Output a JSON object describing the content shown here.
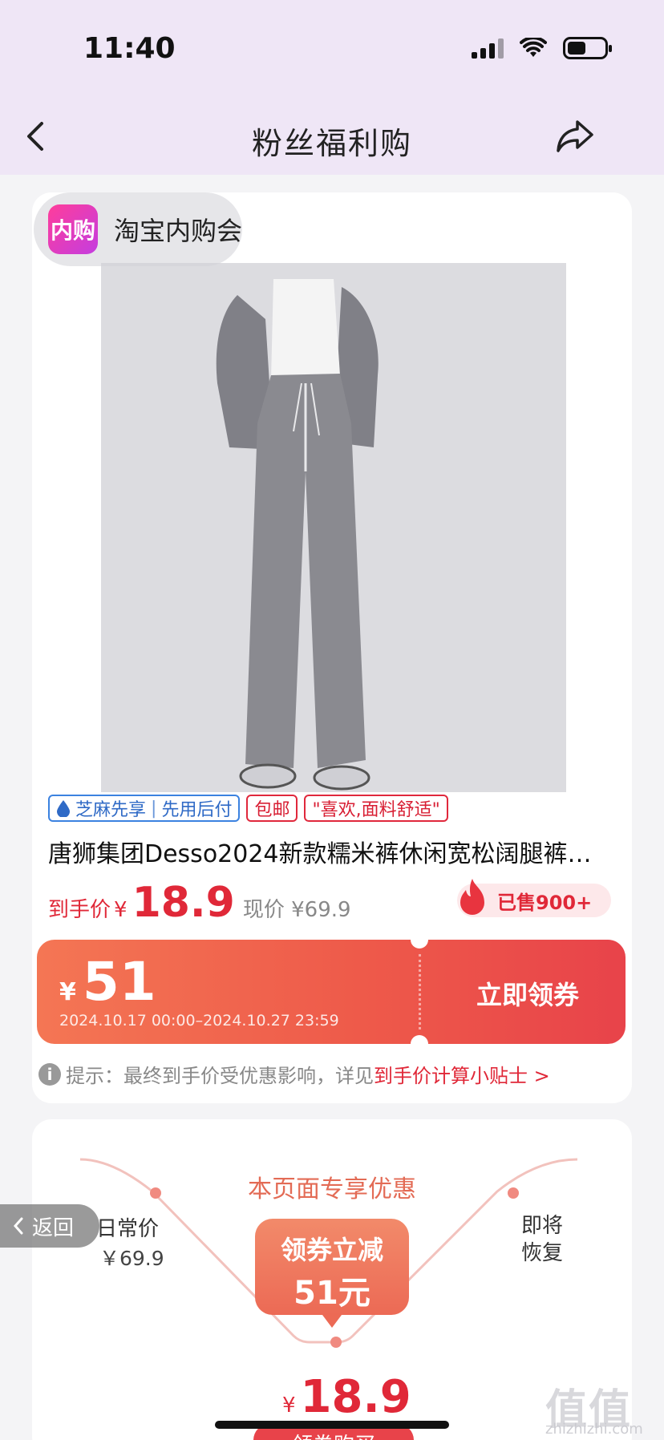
{
  "status_bar": {
    "time": "11:40"
  },
  "nav": {
    "title": "粉丝福利购"
  },
  "shop": {
    "logo_text": "内购",
    "name": "淘宝内购会"
  },
  "product": {
    "tags": {
      "zhima": "芝麻先享",
      "pay_later": "先用后付",
      "free_shipping": "包邮",
      "review": "\"喜欢,面料舒适\""
    },
    "title": "唐狮集团Desso2024新款糯米裤休闲宽松阔腿裤…",
    "price_label": "到手价",
    "currency": "¥",
    "final_price": "18.9",
    "original_price": "现价 ¥69.9",
    "sold": "已售900+"
  },
  "coupon": {
    "currency": "¥",
    "amount": "51",
    "validity": "2024.10.17 00:00–2024.10.27 23:59",
    "button": "立即领券"
  },
  "tip": {
    "icon_text": "i",
    "text": "提示：最终到手价受优惠影响，详见",
    "link": "到手价计算小贴士 >"
  },
  "promo": {
    "heading": "本页面专享优惠",
    "daily_label": "日常价",
    "daily_price": "￥69.9",
    "bubble_line1": "领券立减",
    "bubble_line2": "51元",
    "restore_label": "即将恢复",
    "currency": "¥",
    "final_price": "18.9",
    "bottom_button": "领券购买"
  },
  "float_back": {
    "label": "返回"
  },
  "watermark": {
    "main": "值值值",
    "sub": "zhizhizhi.com"
  },
  "colors": {
    "accent_red": "#e02838",
    "header_bg": "#efe6f6",
    "coupon_gradient_start": "#f47654",
    "coupon_gradient_end": "#e8434a"
  }
}
